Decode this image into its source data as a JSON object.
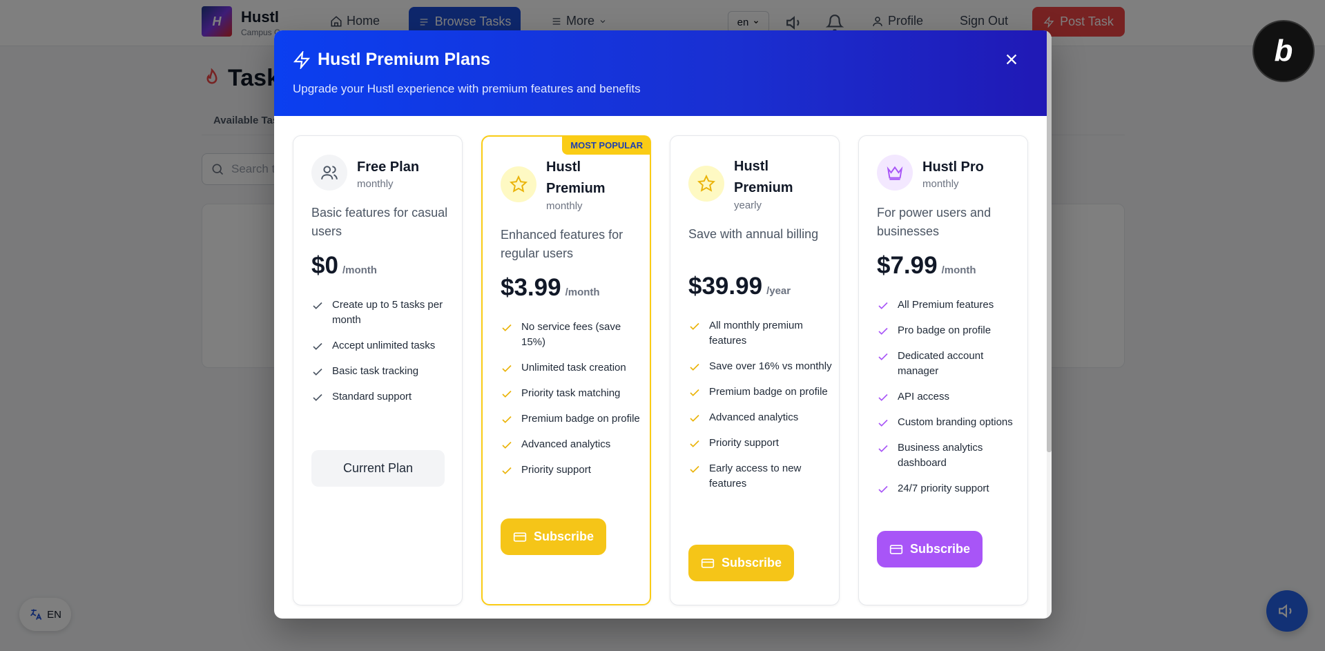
{
  "nav": {
    "logo_letter": "H",
    "brand": "Hustl",
    "brand_sub": "Campus C",
    "home": "Home",
    "browse": "Browse Tasks",
    "more": "More",
    "lang": "en",
    "profile": "Profile",
    "signout": "Sign Out",
    "post_task": "Post Task",
    "bolt_letter": "b"
  },
  "page": {
    "title": "Task",
    "tab": "Available Tas",
    "search_placeholder": "Search t"
  },
  "float": {
    "lang": "EN"
  },
  "modal": {
    "title": "Hustl Premium Plans",
    "subtitle": "Upgrade your Hustl experience with premium features and benefits",
    "popular_badge": "MOST POPULAR",
    "plans": [
      {
        "name": "Free Plan",
        "period": "monthly",
        "description": "Basic features for casual users",
        "price": "$0",
        "unit": "/month",
        "features": [
          "Create up to 5 tasks per month",
          "Accept unlimited tasks",
          "Basic task tracking",
          "Standard support"
        ],
        "button": "Current Plan"
      },
      {
        "name": "Hustl Premium",
        "period": "monthly",
        "description": "Enhanced features for regular users",
        "price": "$3.99",
        "unit": "/month",
        "features": [
          "No service fees (save 15%)",
          "Unlimited task creation",
          "Priority task matching",
          "Premium badge on profile",
          "Advanced analytics",
          "Priority support"
        ],
        "button": "Subscribe"
      },
      {
        "name": "Hustl Premium",
        "period": "yearly",
        "description": "Save with annual billing",
        "price": "$39.99",
        "unit": "/year",
        "features": [
          "All monthly premium features",
          "Save over 16% vs monthly",
          "Premium badge on profile",
          "Advanced analytics",
          "Priority support",
          "Early access to new features"
        ],
        "button": "Subscribe"
      },
      {
        "name": "Hustl Pro",
        "period": "monthly",
        "description": "For power users and businesses",
        "price": "$7.99",
        "unit": "/month",
        "features": [
          "All Premium features",
          "Pro badge on profile",
          "Dedicated account manager",
          "API access",
          "Custom branding options",
          "Business analytics dashboard",
          "24/7 priority support"
        ],
        "button": "Subscribe"
      }
    ]
  },
  "colors": {
    "primary": "#1d4ed8",
    "accent_red": "#ef4444",
    "popular_yellow": "#facc15",
    "pro_purple": "#a855f7",
    "check_gray": "#4b5563"
  }
}
